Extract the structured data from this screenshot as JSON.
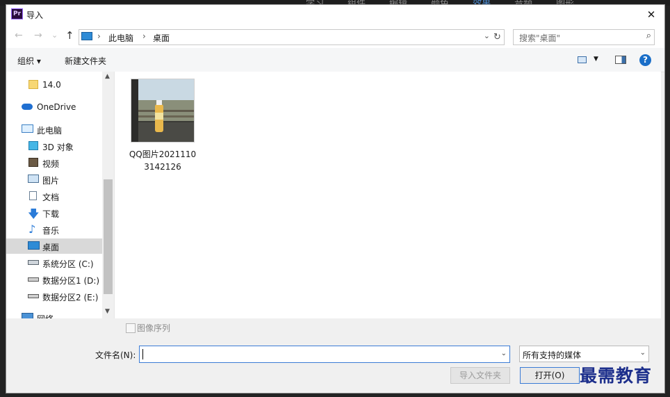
{
  "background_app": {
    "tabs": [
      "学习",
      "组件",
      "编辑",
      "颜色",
      "效果",
      "音频",
      "图形"
    ],
    "active_tab": 4
  },
  "dialog": {
    "title": "导入",
    "app_icon": "Pr",
    "close_icon": "✕"
  },
  "nav": {
    "back_icon": "←",
    "forward_icon": "→",
    "recent_icon": "⌄",
    "up_icon": "↑",
    "breadcrumbs": [
      "此电脑",
      "桌面"
    ],
    "breadcrumb_sep": "›",
    "address_drop_icon": "⌄",
    "refresh_icon": "↻",
    "search_placeholder": "搜索\"桌面\"",
    "search_icon": "⌕"
  },
  "toolbar": {
    "organize_label": "组织 ▾",
    "new_folder_label": "新建文件夹",
    "view_drop_icon": "▼",
    "help_icon": "?"
  },
  "sidebar": {
    "scroll_up": "▲",
    "scroll_down": "▼",
    "items": [
      {
        "label": "14.0",
        "icon": "folder-icon"
      },
      {
        "label": "OneDrive",
        "icon": "cloud-icon"
      },
      {
        "label": "此电脑",
        "icon": "computer-icon"
      },
      {
        "label": "3D 对象",
        "icon": "cube-icon"
      },
      {
        "label": "视频",
        "icon": "film-icon"
      },
      {
        "label": "图片",
        "icon": "picture-icon"
      },
      {
        "label": "文档",
        "icon": "document-icon"
      },
      {
        "label": "下载",
        "icon": "download-icon"
      },
      {
        "label": "音乐",
        "icon": "music-icon"
      },
      {
        "label": "桌面",
        "icon": "desktop-icon"
      },
      {
        "label": "系统分区 (C:)",
        "icon": "system-drive-icon"
      },
      {
        "label": "数据分区1 (D:)",
        "icon": "drive-icon"
      },
      {
        "label": "数据分区2 (E:)",
        "icon": "drive-icon"
      },
      {
        "label": "网络",
        "icon": "network-icon"
      }
    ],
    "selected_index": 9
  },
  "files": [
    {
      "name": "QQ图片20211103142126",
      "type": "image"
    }
  ],
  "options": {
    "image_sequence_label": "图像序列",
    "image_sequence_checked": false
  },
  "footer": {
    "filename_label": "文件名(N):",
    "filename_value": "",
    "filename_drop_icon": "⌄",
    "filetype_value": "所有支持的媒体",
    "filetype_drop_icon": "⌄",
    "import_folder_label": "导入文件夹",
    "open_label": "打开(O)"
  },
  "watermark": "最需教育",
  "colors": {
    "accent": "#3a7bd5",
    "selection": "#d9d9d9",
    "help": "#1a6ec8"
  }
}
